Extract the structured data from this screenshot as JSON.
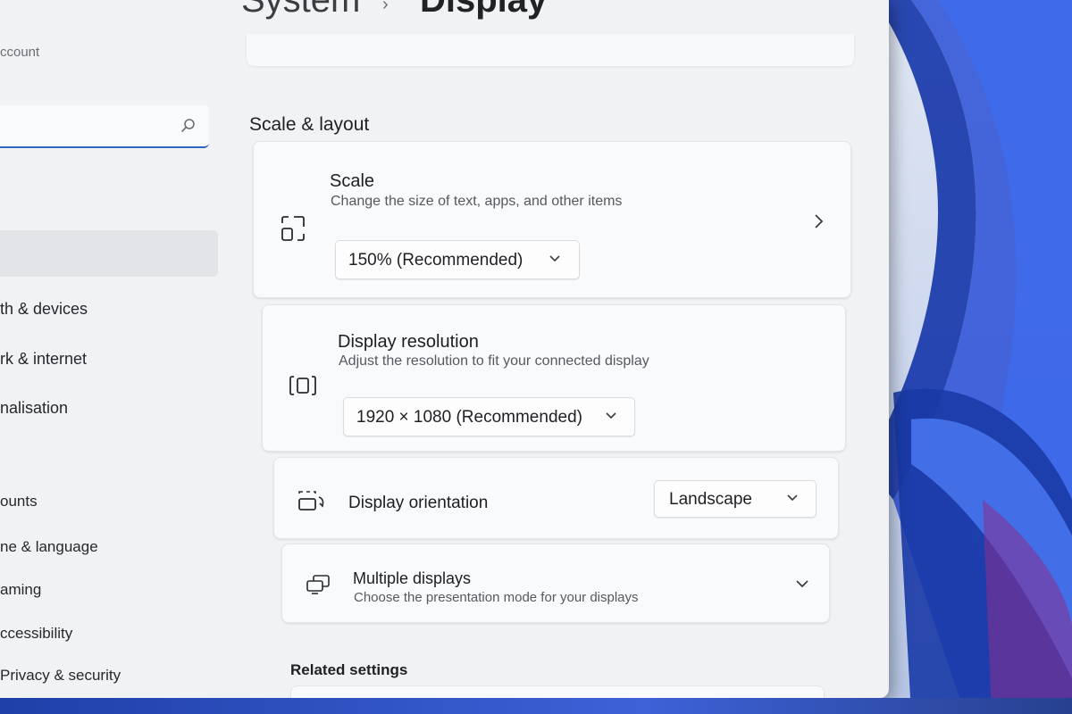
{
  "header": {
    "breadcrumb_parent": "System",
    "breadcrumb_sep": "›",
    "breadcrumb_current": "Display"
  },
  "sidebar": {
    "account_label": "ccount",
    "search_placeholder": "",
    "items": [
      {
        "label": "th & devices"
      },
      {
        "label": "rk & internet"
      },
      {
        "label": "nalisation"
      },
      {
        "label": "ounts"
      },
      {
        "label": "ne & language"
      },
      {
        "label": "aming"
      },
      {
        "label": "ccessibility"
      },
      {
        "label": "Privacy & security"
      }
    ]
  },
  "main": {
    "section_title": "Scale & layout",
    "scale": {
      "title": "Scale",
      "subtitle": "Change the size of text, apps, and other items",
      "value": "150% (Recommended)",
      "icon": "scale-icon"
    },
    "resolution": {
      "title": "Display resolution",
      "subtitle": "Adjust the resolution to fit your connected display",
      "value": "1920 × 1080 (Recommended)",
      "icon": "resolution-icon"
    },
    "orientation": {
      "title": "Display orientation",
      "value": "Landscape",
      "icon": "orientation-icon"
    },
    "multiple": {
      "title": "Multiple displays",
      "subtitle": "Choose the presentation mode for your displays",
      "icon": "multiple-displays-icon"
    },
    "related_title": "Related settings"
  },
  "colors": {
    "accent": "#2f63c5",
    "wallpaper_blue": "#1b3fbf"
  }
}
